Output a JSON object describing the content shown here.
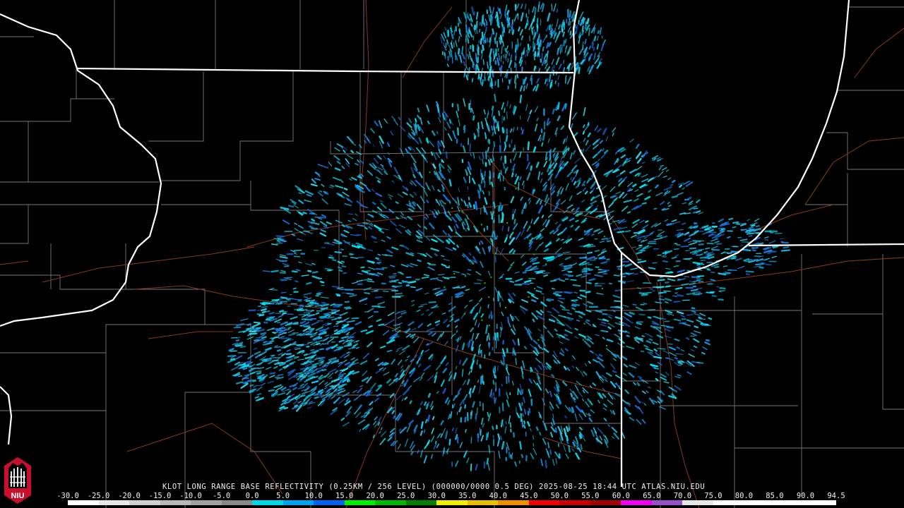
{
  "caption": "KLOT LONG RANGE BASE REFLECTIVITY (0.25KM / 256 LEVEL) (000000/0000 0.5 DEG) 2025-08-25 18:44 UTC  ATLAS.NIU.EDU",
  "logo_text": "NIU",
  "scale": {
    "labels": [
      "-30.0",
      "-25.0",
      "-20.0",
      "-15.0",
      "-10.0",
      "-5.0",
      "0.0",
      "5.0",
      "10.0",
      "15.0",
      "20.0",
      "25.0",
      "30.0",
      "35.0",
      "40.0",
      "45.0",
      "50.0",
      "55.0",
      "60.0",
      "65.0",
      "70.0",
      "75.0",
      "80.0",
      "85.0",
      "90.0",
      "94.5"
    ],
    "colors": [
      "#ffffff",
      "#e8e8e8",
      "#d0d0d0",
      "#b8b8b8",
      "#a0a0a0",
      "#888888",
      "#00d8e8",
      "#00a0f0",
      "#0064f0",
      "#00f000",
      "#00b800",
      "#008000",
      "#f0f000",
      "#e8c000",
      "#f09000",
      "#f00000",
      "#c80000",
      "#a00000",
      "#f000f0",
      "#9850c8",
      "#e8e8e8",
      "#ffffff",
      "#ffffff",
      "#ffffff",
      "#ffffff"
    ]
  },
  "map": {
    "echo_palette": [
      "#00e8f8",
      "#14c8f0",
      "#1898e8",
      "#1a6ee0",
      "#22b8d8",
      "#30d8e8"
    ],
    "state_border_color": "#ffffff",
    "county_line_color": "#777777",
    "road_color": "#8a3a1a",
    "radar_site": "KLOT"
  }
}
